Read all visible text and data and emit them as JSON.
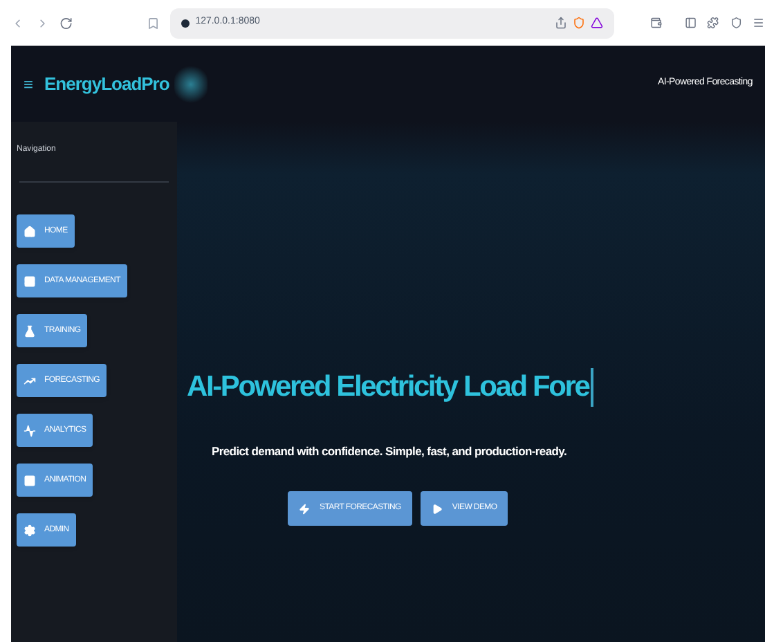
{
  "browser": {
    "url": "127.0.0.1:8080"
  },
  "header": {
    "brand": "EnergyLoadPro",
    "tagline": "AI-Powered Forecasting",
    "menu_glyph": "≡"
  },
  "sidebar": {
    "title": "Navigation",
    "items": [
      {
        "label": "HOME"
      },
      {
        "label": "DATA MANAGEMENT"
      },
      {
        "label": "TRAINING"
      },
      {
        "label": "FORECASTING"
      },
      {
        "label": "ANALYTICS"
      },
      {
        "label": "ANIMATION"
      },
      {
        "label": "ADMIN"
      }
    ]
  },
  "hero": {
    "title": "AI-Powered Electricity Load Fore",
    "subtitle": "Predict demand with confidence. Simple, fast, and production-ready.",
    "buttons": [
      {
        "label": "START FORECASTING"
      },
      {
        "label": "VIEW DEMO"
      }
    ]
  }
}
